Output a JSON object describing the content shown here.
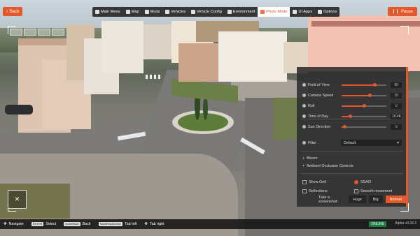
{
  "top_bar": {
    "back_label": "Back",
    "pause_label": "Pause",
    "menu": [
      {
        "label": "Main Menu",
        "icon": "home-icon"
      },
      {
        "label": "Map",
        "icon": "map-icon"
      },
      {
        "label": "Mods",
        "icon": "mods-icon"
      },
      {
        "label": "Vehicles",
        "icon": "car-icon"
      },
      {
        "label": "Vehicle Config",
        "icon": "wrench-icon"
      },
      {
        "label": "Environment",
        "icon": "cloud-icon"
      },
      {
        "label": "Photo Mode",
        "icon": "camera-icon",
        "active": true
      },
      {
        "label": "UI Apps",
        "icon": "apps-icon"
      },
      {
        "label": "Options",
        "icon": "gear-icon"
      }
    ]
  },
  "photo_panel": {
    "sliders": [
      {
        "label": "Field of View",
        "value": "60",
        "level": 0.72
      },
      {
        "label": "Camera Speed",
        "value": "15",
        "level": 0.62
      },
      {
        "label": "Roll",
        "value": "0",
        "level": 0.5
      },
      {
        "label": "Time of Day",
        "value": "16:48",
        "level": 0.18
      },
      {
        "label": "Sun Direction",
        "value": "0",
        "level": 0.05
      }
    ],
    "filter_label": "Filter",
    "filter_value": "Default",
    "expanders": [
      {
        "label": "Bloom"
      },
      {
        "label": "Ambient Occlusion Controls"
      }
    ],
    "checks": [
      {
        "label": "Show Grid",
        "checked": false
      },
      {
        "label": "SSAO",
        "checked": true
      },
      {
        "label": "Reflections",
        "checked": false
      },
      {
        "label": "Smooth movement",
        "checked": false
      }
    ],
    "screenshot_label": "Take a screenshot:",
    "sizes": [
      "Huge",
      "Big",
      "Normal"
    ],
    "selected_size": "Normal",
    "accent": "#e25a2c"
  },
  "bottom_bar": {
    "hints": [
      {
        "key": "",
        "label": "Navigate"
      },
      {
        "key": "ENTER",
        "label": "Select"
      },
      {
        "key": "NUMPAD0",
        "label": "Back"
      },
      {
        "key": "NUMPADDIVIDE",
        "label": "Tab left"
      },
      {
        "key": "",
        "label": "Tab right"
      }
    ],
    "status": "ONLINE",
    "version": "Alpha v0.32.2"
  }
}
